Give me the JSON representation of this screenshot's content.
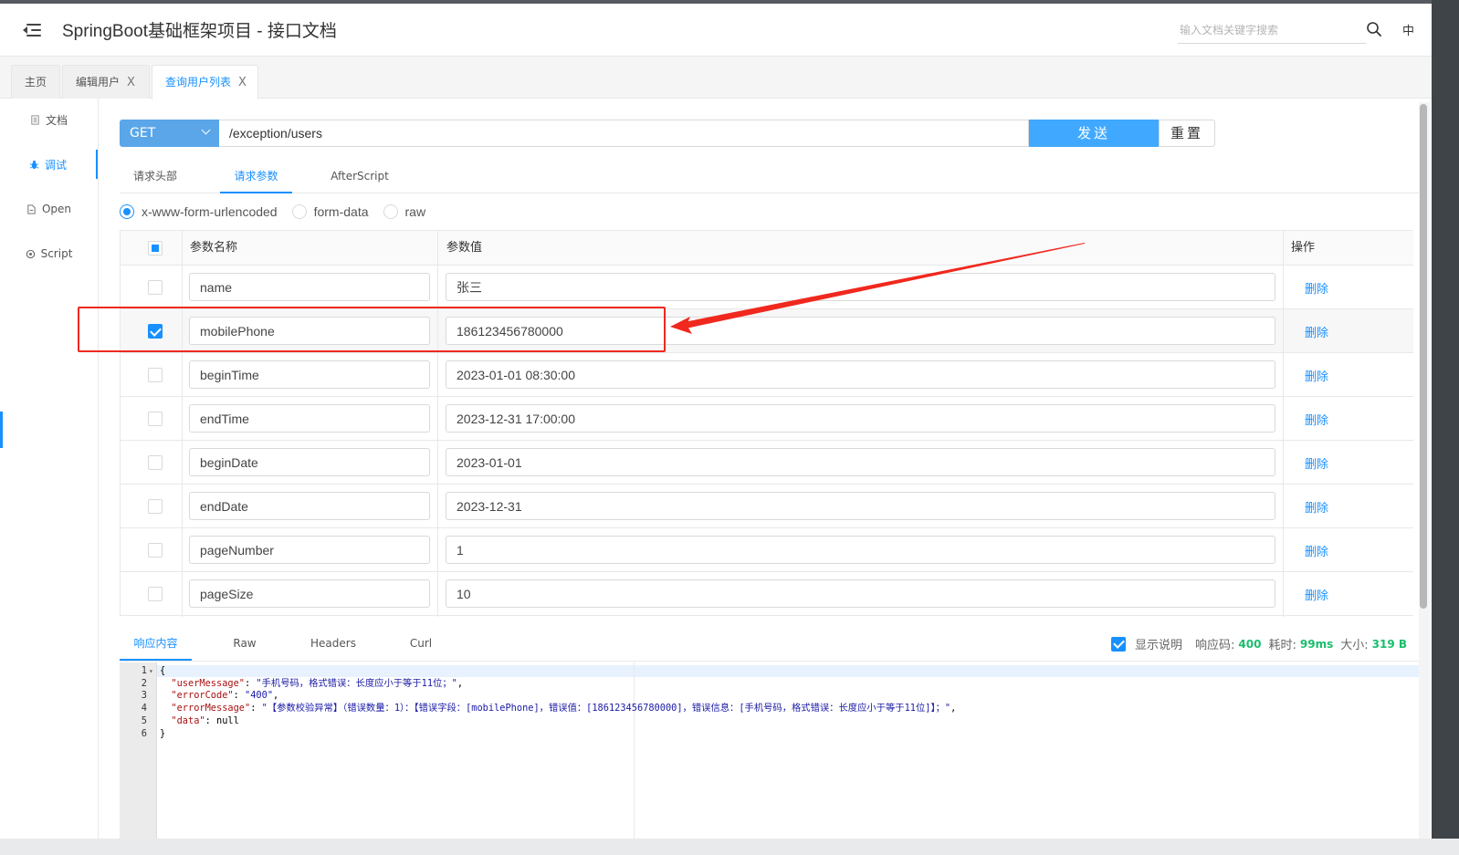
{
  "header": {
    "title": "SpringBoot基础框架项目 - 接口文档",
    "search_placeholder": "输入文档关键字搜索",
    "lang": "中"
  },
  "tabs": [
    {
      "label": "主页",
      "closable": false,
      "active": false
    },
    {
      "label": "编辑用户",
      "closable": true,
      "active": false
    },
    {
      "label": "查询用户列表",
      "closable": true,
      "active": true
    }
  ],
  "tab_close_glyph": "X",
  "leftnav": [
    {
      "label": "文档",
      "icon": "document-icon",
      "active": false
    },
    {
      "label": "调试",
      "icon": "bug-icon",
      "active": true
    },
    {
      "label": "Open",
      "icon": "file-icon",
      "active": false
    },
    {
      "label": "Script",
      "icon": "script-icon",
      "active": false
    }
  ],
  "request": {
    "method": "GET",
    "url": "/exception/users",
    "send_label": "发送",
    "reset_label": "重置"
  },
  "request_tabs": [
    "请求头部",
    "请求参数",
    "AfterScript"
  ],
  "active_request_tab": 1,
  "body_types": [
    {
      "label": "x-www-form-urlencoded",
      "checked": true
    },
    {
      "label": "form-data",
      "checked": false
    },
    {
      "label": "raw",
      "checked": false
    }
  ],
  "params_table": {
    "headers": {
      "name": "参数名称",
      "value": "参数值",
      "action": "操作"
    },
    "delete_label": "删除",
    "rows": [
      {
        "name": "name",
        "value": "张三",
        "checked": false
      },
      {
        "name": "mobilePhone",
        "value": "186123456780000",
        "checked": true
      },
      {
        "name": "beginTime",
        "value": "2023-01-01 08:30:00",
        "checked": false
      },
      {
        "name": "endTime",
        "value": "2023-12-31 17:00:00",
        "checked": false
      },
      {
        "name": "beginDate",
        "value": "2023-01-01",
        "checked": false
      },
      {
        "name": "endDate",
        "value": "2023-12-31",
        "checked": false
      },
      {
        "name": "pageNumber",
        "value": "1",
        "checked": false
      },
      {
        "name": "pageSize",
        "value": "10",
        "checked": false
      }
    ]
  },
  "response_tabs": [
    "响应内容",
    "Raw",
    "Headers",
    "Curl"
  ],
  "active_response_tab": 0,
  "response_meta": {
    "show_desc_label": "显示说明",
    "status_label": "响应码:",
    "status_value": "400",
    "time_label": "耗时:",
    "time_value": "99ms",
    "size_label": "大小:",
    "size_value": "319 B"
  },
  "response_code_lines": [
    {
      "no": "1",
      "text": "{"
    },
    {
      "no": "2",
      "key": "\"userMessage\"",
      "value": "\"手机号码，格式错误：长度应小于等于11位；\"",
      "tail": ","
    },
    {
      "no": "3",
      "key": "\"errorCode\"",
      "value": "\"400\"",
      "tail": ","
    },
    {
      "no": "4",
      "key": "\"errorMessage\"",
      "value": "\"【参数校验异常】（错误数量：1）：【错误字段：[mobilePhone]，错误值：[186123456780000]，错误信息：[手机号码，格式错误：长度应小于等于11位]】；\"",
      "tail": ","
    },
    {
      "no": "5",
      "key": "\"data\"",
      "value": "null",
      "tail": ""
    },
    {
      "no": "6",
      "text": "}"
    }
  ],
  "colors": {
    "accent": "#1890ff",
    "send_button": "#40a9ff",
    "method_select": "#5aa6e8",
    "annotation_red": "#f0281e",
    "status_green": "#19be6b"
  }
}
